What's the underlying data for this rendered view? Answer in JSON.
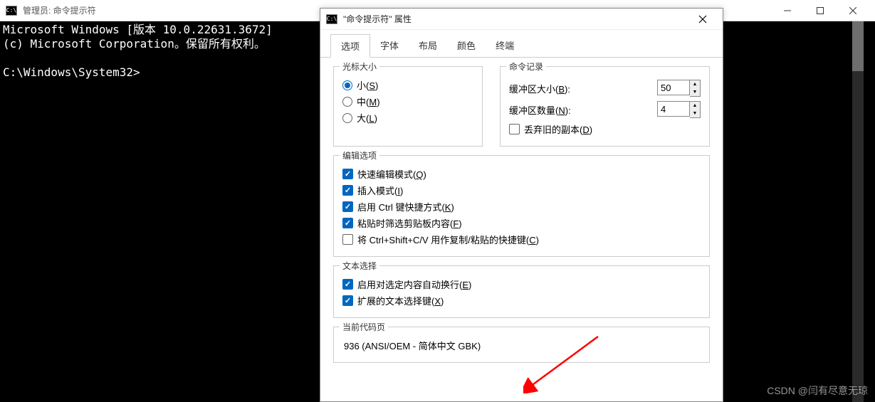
{
  "terminal": {
    "title": "管理员: 命令提示符",
    "line1": "Microsoft Windows [版本 10.0.22631.3672]",
    "line2": "(c) Microsoft Corporation。保留所有权利。",
    "prompt": "C:\\Windows\\System32>"
  },
  "dialog": {
    "title": "\"命令提示符\" 属性",
    "tabs": [
      "选项",
      "字体",
      "布局",
      "颜色",
      "终端"
    ],
    "cursor": {
      "title": "光标大小",
      "small": "小(S)",
      "medium": "中(M)",
      "large": "大(L)"
    },
    "history": {
      "title": "命令记录",
      "buffer_label": "缓冲区大小(B):",
      "buffer_value": "50",
      "count_label": "缓冲区数量(N):",
      "count_value": "4",
      "discard": "丢弃旧的副本(D)"
    },
    "edit": {
      "title": "编辑选项",
      "quick": "快速编辑模式(Q)",
      "insert": "插入模式(I)",
      "ctrl": "启用 Ctrl 键快捷方式(K)",
      "filter": "粘贴时筛选剪贴板内容(F)",
      "csv": "将 Ctrl+Shift+C/V 用作复制/粘贴的快捷键(C)"
    },
    "text": {
      "title": "文本选择",
      "wrap": "启用对选定内容自动换行(E)",
      "ext": "扩展的文本选择键(X)"
    },
    "code": {
      "title": "当前代码页",
      "value": "936   (ANSI/OEM - 简体中文 GBK)"
    }
  },
  "watermark": "CSDN @闫有尽意无琼"
}
